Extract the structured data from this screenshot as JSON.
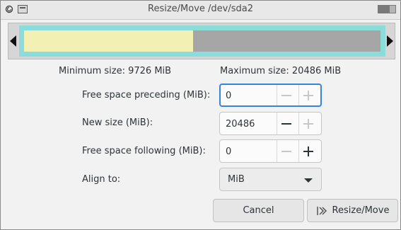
{
  "window": {
    "title": "Resize/Move /dev/sda2"
  },
  "partition_bar": {
    "used_fraction": 0.475,
    "used_color": "#f3f0b4",
    "free_color": "#a6a6a6",
    "border_color": "#8cdcdc"
  },
  "limits": {
    "minimum_label": "Minimum size: 9726 MiB",
    "maximum_label": "Maximum size: 20486 MiB"
  },
  "fields": {
    "free_before": {
      "label": "Free space preceding (MiB):",
      "value": "0"
    },
    "new_size": {
      "label": "New size (MiB):",
      "value": "20486"
    },
    "free_after": {
      "label": "Free space following (MiB):",
      "value": "0"
    },
    "align": {
      "label": "Align to:",
      "selected": "MiB"
    }
  },
  "buttons": {
    "cancel": "Cancel",
    "resize": "Resize/Move"
  },
  "colors": {
    "accent": "#3584e4"
  }
}
